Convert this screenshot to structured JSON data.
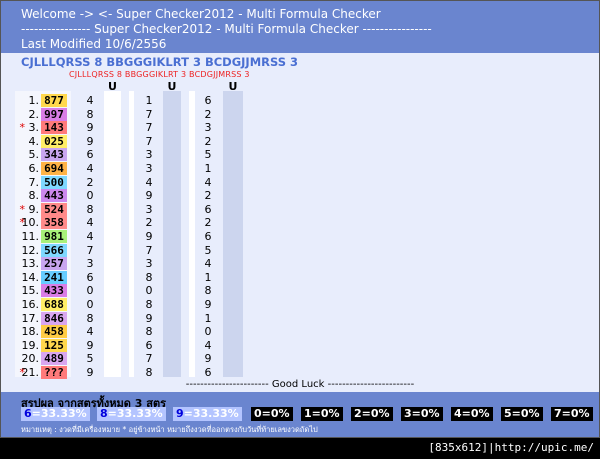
{
  "header": {
    "line1": "Welcome -> <- Super Checker2012 - Multi Formula Checker",
    "line2": "---------------- Super Checker2012 - Multi Formula Checker ----------------",
    "line3": "Last Modified 10/6/2556"
  },
  "title": "CJLLLQRSS 8 BBGGGIKLRT 3 BCDGJJMRSS 3",
  "subtitle": "CJLLLQRSS 8  BBGGGIKLRT 3  BCDGJJMRSS 3",
  "col_header": "U",
  "rows": [
    {
      "n": "1.",
      "star": "",
      "val": "877",
      "c1": "4",
      "c2": "1",
      "c3": "6"
    },
    {
      "n": "2.",
      "star": "",
      "val": "997",
      "c1": "8",
      "c2": "7",
      "c3": "2"
    },
    {
      "n": "3.",
      "star": "*",
      "val": "143",
      "c1": "9",
      "c2": "7",
      "c3": "3"
    },
    {
      "n": "4.",
      "star": "",
      "val": "025",
      "c1": "9",
      "c2": "7",
      "c3": "2"
    },
    {
      "n": "5.",
      "star": "",
      "val": "343",
      "c1": "6",
      "c2": "3",
      "c3": "5"
    },
    {
      "n": "6.",
      "star": "",
      "val": "694",
      "c1": "4",
      "c2": "3",
      "c3": "1"
    },
    {
      "n": "7.",
      "star": "",
      "val": "500",
      "c1": "2",
      "c2": "4",
      "c3": "4"
    },
    {
      "n": "8.",
      "star": "",
      "val": "443",
      "c1": "0",
      "c2": "9",
      "c3": "2"
    },
    {
      "n": "9.",
      "star": "*",
      "val": "524",
      "c1": "8",
      "c2": "3",
      "c3": "6"
    },
    {
      "n": "10.",
      "star": "*",
      "val": "358",
      "c1": "4",
      "c2": "2",
      "c3": "2"
    },
    {
      "n": "11.",
      "star": "",
      "val": "981",
      "c1": "4",
      "c2": "9",
      "c3": "6"
    },
    {
      "n": "12.",
      "star": "",
      "val": "566",
      "c1": "7",
      "c2": "7",
      "c3": "5"
    },
    {
      "n": "13.",
      "star": "",
      "val": "257",
      "c1": "3",
      "c2": "3",
      "c3": "4"
    },
    {
      "n": "14.",
      "star": "",
      "val": "241",
      "c1": "6",
      "c2": "8",
      "c3": "1"
    },
    {
      "n": "15.",
      "star": "",
      "val": "433",
      "c1": "0",
      "c2": "0",
      "c3": "8"
    },
    {
      "n": "16.",
      "star": "",
      "val": "688",
      "c1": "0",
      "c2": "8",
      "c3": "9"
    },
    {
      "n": "17.",
      "star": "",
      "val": "846",
      "c1": "8",
      "c2": "9",
      "c3": "1"
    },
    {
      "n": "18.",
      "star": "",
      "val": "458",
      "c1": "4",
      "c2": "8",
      "c3": "0"
    },
    {
      "n": "19.",
      "star": "",
      "val": "125",
      "c1": "9",
      "c2": "6",
      "c3": "4"
    },
    {
      "n": "20.",
      "star": "",
      "val": "489",
      "c1": "5",
      "c2": "7",
      "c3": "9"
    },
    {
      "n": "21.",
      "star": "*",
      "val": "???",
      "c1": "9",
      "c2": "8",
      "c3": "6"
    }
  ],
  "value_colors": [
    "#ffd84d",
    "#d97de6",
    "#ff7a7a",
    "#ffee66",
    "#c9a6f0",
    "#ffb347",
    "#7fd8ff",
    "#cc88ee",
    "#ff8a8a",
    "#ff8a8a",
    "#a8f07a",
    "#7fd8ff",
    "#c9a6f0",
    "#66ccff",
    "#d97de6",
    "#ffee66",
    "#d9a6f0",
    "#ffcc44",
    "#ffd84d",
    "#d9a6f0",
    "#ff7a7a"
  ],
  "good_luck": "----------------------- Good Luck ------------------------",
  "summary": {
    "title": "สรุปผล จากสูตรทั้งหมด 3 สูตร",
    "pos": [
      {
        "k": "6",
        "rest": "=33.33%"
      },
      {
        "k": "8",
        "rest": "=33.33%"
      },
      {
        "k": "9",
        "rest": "=33.33%"
      }
    ],
    "zeros": [
      "0=0%",
      "1=0%",
      "2=0%",
      "3=0%",
      "4=0%",
      "5=0%",
      "7=0%"
    ],
    "note": "หมายเหตุ : งวดที่มีเครื่องหมาย * อยู่ข้างหน้า หมายถึงงวดที่ออกตรงกับวันที่ท้ายเลขงวดถัดไป"
  },
  "watermark": "[835x612]|http://upic.me/"
}
